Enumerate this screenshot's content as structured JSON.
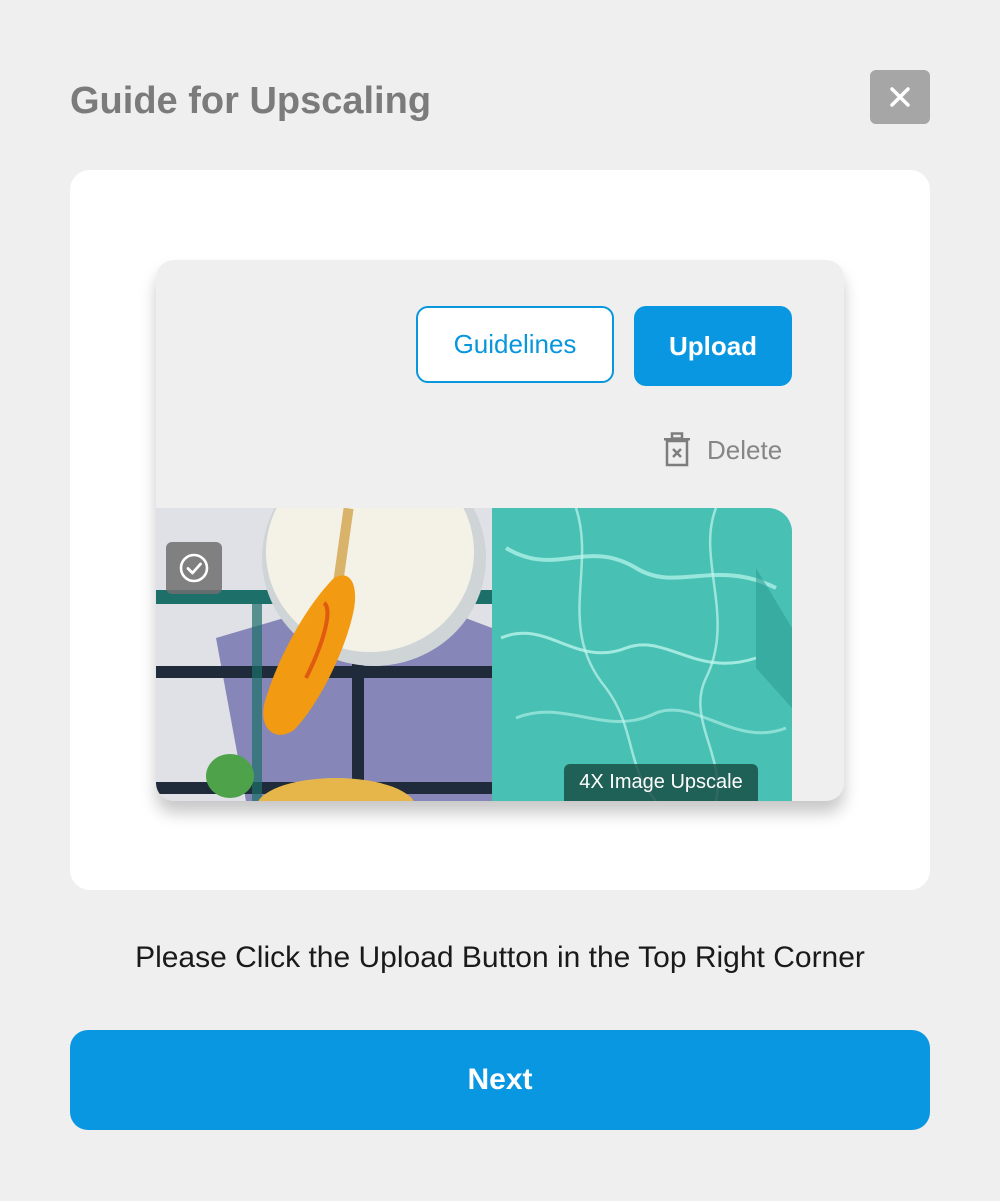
{
  "modal": {
    "title": "Guide for Upscaling",
    "close_icon": "close-icon"
  },
  "preview": {
    "guidelines_label": "Guidelines",
    "upload_label": "Upload",
    "delete_label": "Delete",
    "delete_icon": "trash-icon",
    "check_icon": "check-circle-icon",
    "badge_label": "4X Image Upscale"
  },
  "instruction": "Please Click the Upload Button in the Top Right Corner",
  "next_label": "Next",
  "colors": {
    "accent": "#0897e0",
    "background": "#efefef",
    "title": "#7b7b7b"
  }
}
